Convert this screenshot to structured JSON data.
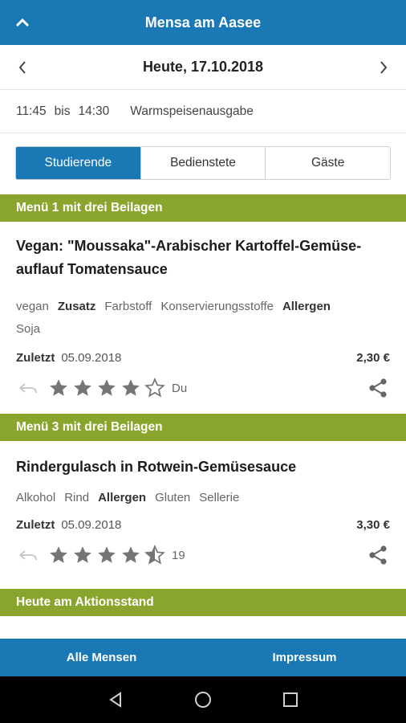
{
  "header": {
    "title": "Mensa am Aasee"
  },
  "date_nav": {
    "date": "Heute, 17.10.2018"
  },
  "hours": {
    "from": "11:45",
    "sep": "bis",
    "to": "14:30",
    "label": "Warmspeisenausgabe"
  },
  "segments": {
    "items": [
      "Studierende",
      "Bedienstete",
      "Gäste"
    ],
    "active": "Studierende"
  },
  "sections": [
    {
      "title": "Menü 1 mit drei Beilagen",
      "meal": {
        "name_line1": "Vegan: \"Moussaka\"-Arabischer Kartoffel-Gemüse-",
        "name_line2": "auflauf Tomatensauce",
        "tags_line1": [
          {
            "text": "vegan",
            "bold": false
          },
          {
            "text": "Zusatz",
            "bold": true
          },
          {
            "text": "Farbstoff",
            "bold": false
          },
          {
            "text": "Konservierungsstoffe",
            "bold": false
          },
          {
            "text": "Allergen",
            "bold": true
          }
        ],
        "tags_line2": [
          {
            "text": "Soja",
            "bold": false
          }
        ],
        "last_label": "Zuletzt",
        "last_date": "05.09.2018",
        "price": "2,30 €",
        "rating": 4,
        "rating_label": "Du"
      }
    },
    {
      "title": "Menü 3 mit drei Beilagen",
      "meal": {
        "name_line1": "Rindergulasch in Rotwein-Gemüsesauce",
        "tags_line1": [
          {
            "text": "Alkohol",
            "bold": false
          },
          {
            "text": "Rind",
            "bold": false
          },
          {
            "text": "Allergen",
            "bold": true
          },
          {
            "text": "Gluten",
            "bold": false
          },
          {
            "text": "Sellerie",
            "bold": false
          }
        ],
        "last_label": "Zuletzt",
        "last_date": "05.09.2018",
        "price": "3,30 €",
        "rating": 4.5,
        "rating_label": "19"
      }
    },
    {
      "title": "Heute am Aktionsstand"
    }
  ],
  "bottom": {
    "left": "Alle Mensen",
    "right": "Impressum"
  },
  "colors": {
    "primary": "#1a78b5",
    "section": "#8aa52d",
    "star": "#757575"
  },
  "icons": {
    "collapse": "chevron-up-icon",
    "prev": "chevron-left-icon",
    "next": "chevron-right-icon",
    "undo": "undo-icon",
    "share": "share-icon"
  }
}
